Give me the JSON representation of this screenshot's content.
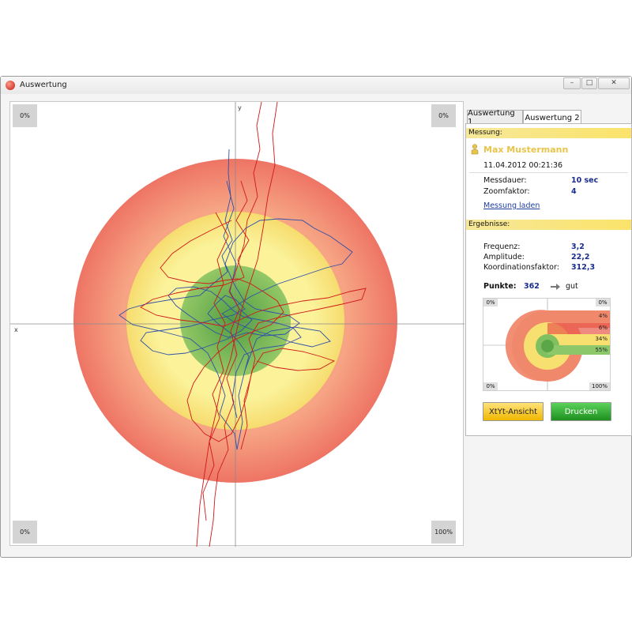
{
  "window": {
    "title": "Auswertung",
    "buttons": {
      "minimize": "–",
      "maximize": "□",
      "close": "✕"
    }
  },
  "plot": {
    "axis_x_label": "x",
    "axis_y_label": "y",
    "corners": {
      "top_left": "0%",
      "top_right": "0%",
      "bottom_left": "0%",
      "bottom_right": "100%"
    },
    "zone_colors": {
      "outer": "#f08070",
      "middle": "#f8e070",
      "inner": "#80c060",
      "center": "#5aa648"
    },
    "trace_colors": {
      "blue": "#3050a8",
      "red": "#d01818"
    }
  },
  "tabs": [
    "Auswertung 1",
    "Auswertung 2"
  ],
  "active_tab": 1,
  "measurement": {
    "header": "Messung:",
    "person_icon": "person-icon",
    "name": "Max Mustermann",
    "datetime": "11.04.2012 00:21:36",
    "duration_label": "Messdauer:",
    "duration_value": "10 sec",
    "zoom_label": "Zoomfaktor:",
    "zoom_value": "4",
    "load_link": "Messung laden"
  },
  "results": {
    "header": "Ergebnisse:",
    "frequency_label": "Frequenz:",
    "frequency_value": "3,2",
    "amplitude_label": "Amplitude:",
    "amplitude_value": "22,2",
    "coordination_label": "Koordinationsfaktor:",
    "coordination_value": "312,3",
    "points_label": "Punkte:",
    "points_value": "362",
    "rating_icon": "arrow-right-icon",
    "rating": "gut"
  },
  "mini_chart": {
    "corners": {
      "top_left": "0%",
      "top_right": "0%",
      "bottom_left": "0%",
      "bottom_right": "100%"
    },
    "bands": [
      "4%",
      "6%",
      "34%",
      "55%"
    ]
  },
  "buttons": {
    "xtyt": "XtYt-Ansicht",
    "print": "Drucken"
  }
}
